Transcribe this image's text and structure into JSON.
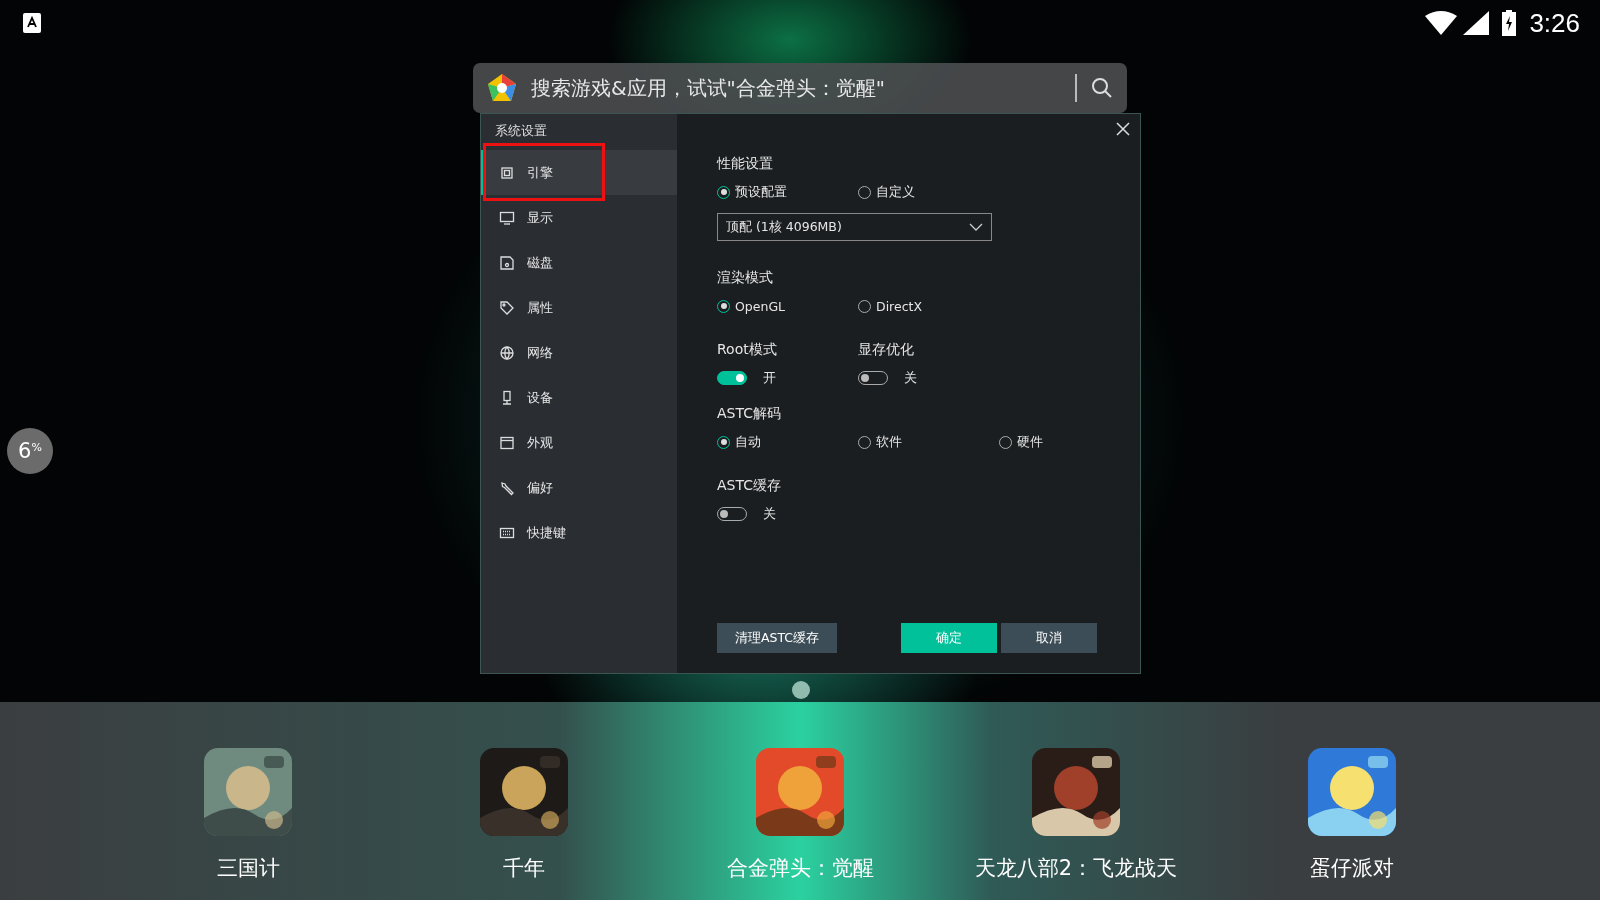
{
  "status_bar": {
    "time": "3:26"
  },
  "search": {
    "placeholder": "搜索游戏&应用，试试\"合金弹头：觉醒\""
  },
  "progress_badge": {
    "value": "6",
    "unit": "%"
  },
  "dialog": {
    "title": "系统设置",
    "nav": [
      {
        "label": "引擎",
        "selected": true,
        "highlighted": true
      },
      {
        "label": "显示",
        "selected": false,
        "highlighted": false
      },
      {
        "label": "磁盘",
        "selected": false,
        "highlighted": false
      },
      {
        "label": "属性",
        "selected": false,
        "highlighted": false
      },
      {
        "label": "网络",
        "selected": false,
        "highlighted": false
      },
      {
        "label": "设备",
        "selected": false,
        "highlighted": false
      },
      {
        "label": "外观",
        "selected": false,
        "highlighted": false
      },
      {
        "label": "偏好",
        "selected": false,
        "highlighted": false
      },
      {
        "label": "快捷键",
        "selected": false,
        "highlighted": false
      }
    ],
    "sections": [
      {
        "kind": "radio",
        "title": "性能设置",
        "options": [
          {
            "label": "预设配置",
            "selected": true
          },
          {
            "label": "自定义",
            "selected": false
          }
        ],
        "dropdown": {
          "value": "顶配 (1核 4096MB)"
        }
      },
      {
        "kind": "radio",
        "title": "渲染模式",
        "options": [
          {
            "label": "OpenGL",
            "selected": true
          },
          {
            "label": "DirectX",
            "selected": false
          }
        ]
      },
      {
        "kind": "toggles",
        "items": [
          {
            "title": "Root模式",
            "on": true,
            "state_label": "开"
          },
          {
            "title": "显存优化",
            "on": false,
            "state_label": "关"
          }
        ]
      },
      {
        "kind": "radio",
        "title": "ASTC解码",
        "options": [
          {
            "label": "自动",
            "selected": true
          },
          {
            "label": "软件",
            "selected": false
          },
          {
            "label": "硬件",
            "selected": false
          }
        ]
      },
      {
        "kind": "toggles",
        "items": [
          {
            "title": "ASTC缓存",
            "on": false,
            "state_label": "关"
          }
        ]
      }
    ],
    "buttons": [
      {
        "label": "清理ASTC缓存",
        "kind": "secondary"
      },
      {
        "label": "确定",
        "kind": "primary"
      },
      {
        "label": "取消",
        "kind": "secondary"
      }
    ]
  },
  "dock": {
    "apps": [
      {
        "label": "三国计"
      },
      {
        "label": "千年"
      },
      {
        "label": "合金弹头：觉醒"
      },
      {
        "label": "天龙八部2：飞龙战天"
      },
      {
        "label": "蛋仔派对"
      }
    ]
  }
}
